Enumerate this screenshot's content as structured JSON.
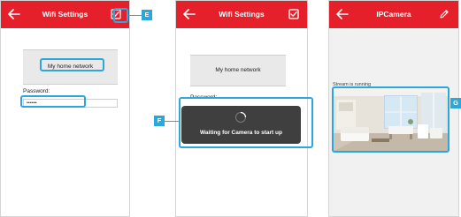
{
  "screen1": {
    "title": "Wifi Settings",
    "network_name": "My home network",
    "password_label": "Password:",
    "password_value": "••••••",
    "callout": "E"
  },
  "screen2": {
    "title": "Wifi Settings",
    "network_name": "My home network",
    "password_label": "Password:",
    "toast_text": "Waiting for Camera to start up",
    "callout": "F"
  },
  "screen3": {
    "title": "IPCamera",
    "stream_status": "Stream is running",
    "callout": "G"
  },
  "icons": {
    "back": "arrow-left-icon",
    "confirm": "checkbox-confirm-icon",
    "edit": "pencil-icon",
    "loading": "spinner-icon"
  },
  "colors": {
    "header": "#e6202a",
    "highlight": "#2aa7df",
    "toast": "#3f3f3f"
  }
}
